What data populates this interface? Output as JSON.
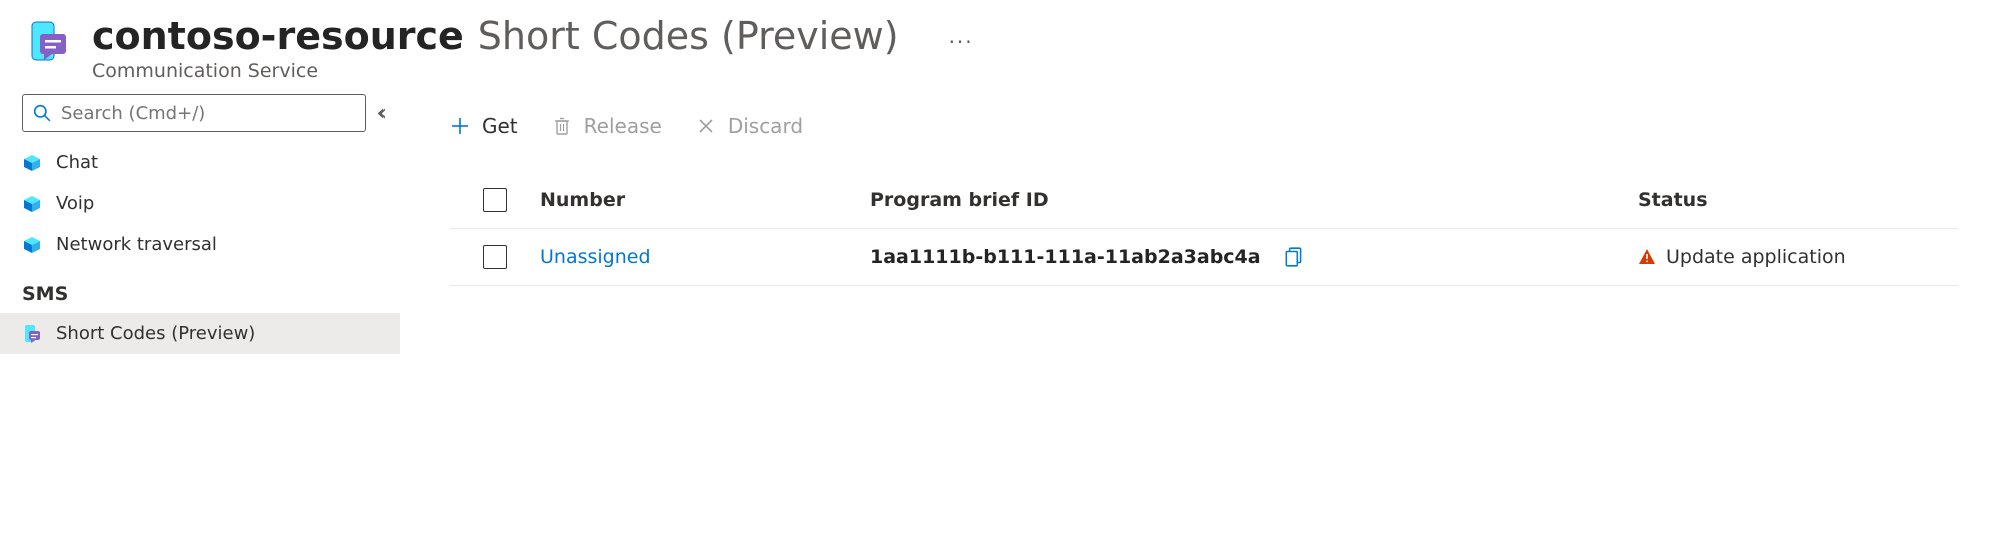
{
  "header": {
    "resource_name": "contoso-resource",
    "page_name": "Short Codes (Preview)",
    "subtitle": "Communication Service"
  },
  "search": {
    "placeholder": "Search (Cmd+/)"
  },
  "sidebar": {
    "items": [
      {
        "label": "Chat"
      },
      {
        "label": "Voip"
      },
      {
        "label": "Network traversal"
      }
    ],
    "section_label": "SMS",
    "sms_items": [
      {
        "label": "Short Codes (Preview)"
      }
    ]
  },
  "toolbar": {
    "get_label": "Get",
    "release_label": "Release",
    "discard_label": "Discard"
  },
  "table": {
    "headers": {
      "number": "Number",
      "brief": "Program brief ID",
      "status": "Status"
    },
    "rows": [
      {
        "number": "Unassigned",
        "brief_id": "1aa1111b-b111-111a-11ab2a3abc4a",
        "status": "Update application"
      }
    ]
  }
}
